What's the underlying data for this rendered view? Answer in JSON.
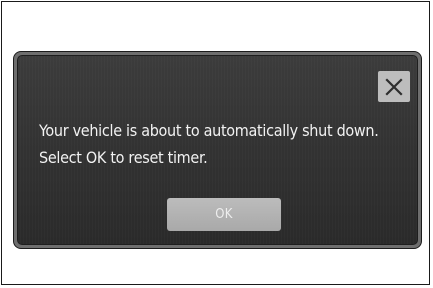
{
  "dialog": {
    "message_line1": "Your vehicle is about to automatically shut down.",
    "message_line2": "Select OK to reset timer.",
    "ok_label": "OK",
    "close_icon": "close-icon"
  },
  "colors": {
    "dialog_background": "#333333",
    "button_background": "#b5b5b5",
    "text": "#f2f2f2"
  }
}
